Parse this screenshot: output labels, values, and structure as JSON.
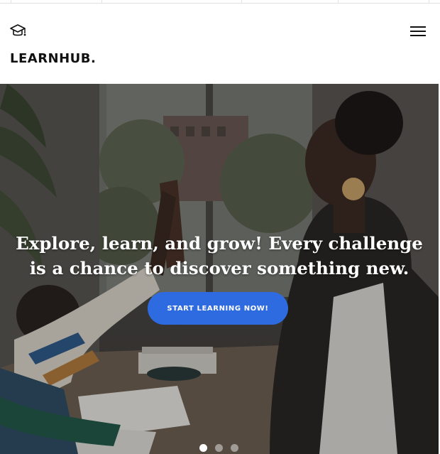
{
  "header": {
    "brand": "LEARNHUB.",
    "logo_icon": "graduation-cap-icon",
    "menu_icon": "hamburger-menu-icon"
  },
  "hero": {
    "headline": "Explore, learn, and grow! Every challenge is a chance to discover something new.",
    "cta_label": "START LEARNING NOW!",
    "slides": {
      "count": 3,
      "active": 1
    }
  },
  "colors": {
    "accent": "#2f6be0",
    "text_dark": "#111111",
    "text_light": "#ffffff"
  }
}
